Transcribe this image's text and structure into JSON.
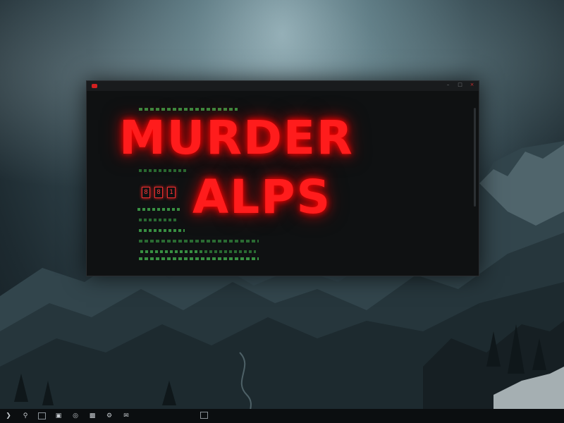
{
  "window": {
    "title": "",
    "controls": [
      "minimize-icon",
      "maximize-icon",
      "close-icon"
    ],
    "menu": [
      "",
      "",
      "",
      ""
    ],
    "toolbar": [
      "",
      "",
      "",
      "",
      "",
      "",
      ""
    ]
  },
  "headline": {
    "line1": "MURDER",
    "line2": "ALPS"
  },
  "glyphs": [
    "8",
    "8",
    "1"
  ],
  "colors": {
    "headline": "#ff1c1c",
    "code": "#3fa54a",
    "window_bg": "#0f1112",
    "taskbar_bg": "#0b0e10"
  },
  "taskbar": {
    "icons": [
      "start-icon",
      "search-icon",
      "task-view-icon",
      "file-explorer-icon",
      "browser-icon",
      "terminal-icon",
      "settings-icon",
      "mail-icon"
    ],
    "tray": [
      "",
      "",
      "",
      ""
    ]
  }
}
